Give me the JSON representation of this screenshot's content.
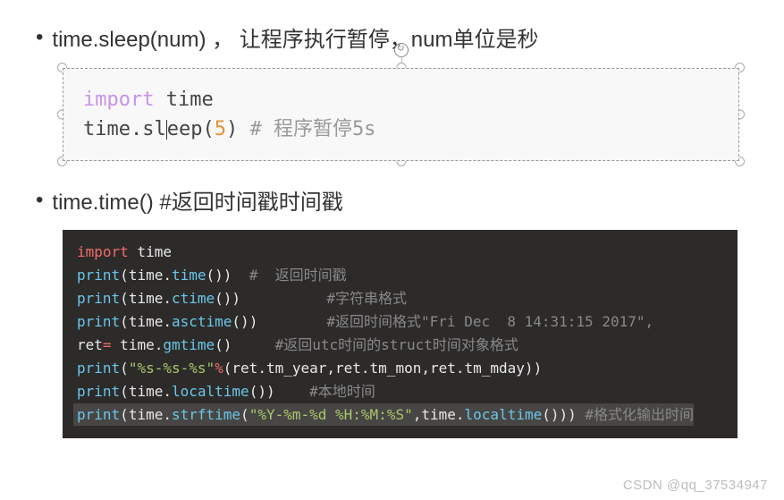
{
  "bullet1": "time.sleep(num) ， 让程序执行暂停，num单位是秒",
  "bullet2": "time.time() #返回时间戳时间戳",
  "code_light": {
    "l1_kw": "import",
    "l1_rest": " time",
    "l2_a": "time.sl",
    "l2_b": "eep(",
    "l2_num": "5",
    "l2_c": ")",
    "l2_cmt": " # 程序暂停5s"
  },
  "code_dark": {
    "l1_kw": "import",
    "l1_rest": " time",
    "l2_fn": "print",
    "l2_inner1": "time.",
    "l2_inner2": "time",
    "l2_cmt": "  #  返回时间戳",
    "l3_fn": "print",
    "l3_inner1": "time.",
    "l3_inner2": "ctime",
    "l3_cmt": "          #字符串格式",
    "l4_fn": "print",
    "l4_inner1": "time.",
    "l4_inner2": "asctime",
    "l4_cmt": "        #返回时间格式\"Fri Dec  8 14:31:15 2017\",",
    "l5_var": "ret",
    "l5_op": "=",
    "l5_inner1": " time.",
    "l5_inner2": "gmtime",
    "l5_cmt": "     #返回utc时间的struct时间对象格式",
    "l6_fn": "print",
    "l6_str": "\"%s-%s-%s\"",
    "l6_op": "%",
    "l6_args": "(ret.tm_year,ret.tm_mon,ret.tm_mday))",
    "l7_fn": "print",
    "l7_inner1": "time.",
    "l7_inner2": "localtime",
    "l7_cmt": "    #本地时间",
    "l8_fn": "print",
    "l8_inner1": "time.",
    "l8_inner2": "strftime",
    "l8_str": "\"%Y-%m-%d %H:%M:%S\"",
    "l8_sep": ",",
    "l8_inner3": "time.",
    "l8_inner4": "localtime",
    "l8_cmt": " #格式化输出时间"
  },
  "watermark": "CSDN @qq_37534947"
}
